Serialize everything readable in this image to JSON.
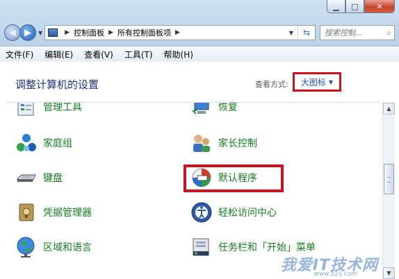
{
  "titlebar": {
    "min": "▁",
    "max": "□",
    "close": "✕"
  },
  "address": {
    "crumbs": [
      "控制面板",
      "所有控制面板项"
    ],
    "search_placeholder": "搜索控制..."
  },
  "menu": [
    "文件(F)",
    "编辑(E)",
    "查看(V)",
    "工具(T)",
    "帮助(H)"
  ],
  "header": {
    "title": "调整计算机的设置",
    "view_by_label": "查看方式:",
    "view_by_value": "大图标"
  },
  "items": {
    "admin_tools": "管理工具",
    "recovery": "恢复",
    "homegroup": "家庭组",
    "parental": "家长控制",
    "keyboard": "键盘",
    "default_programs": "默认程序",
    "credential": "凭据管理器",
    "ease_access": "轻松访问中心",
    "region": "区域和语言",
    "taskbar": "任务栏和「开始」菜单"
  },
  "watermark": {
    "text": "我爱IT技术网",
    "url": "www.52ij.com"
  },
  "colors": {
    "link_green": "#12801e",
    "title_blue": "#1e3287",
    "highlight_red": "#d0101a"
  }
}
